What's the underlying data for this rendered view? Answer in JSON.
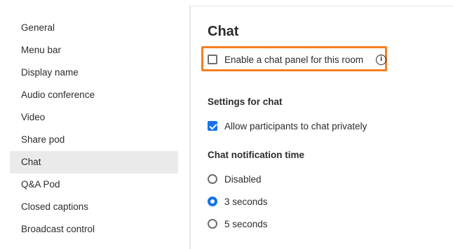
{
  "sidebar": {
    "items": [
      {
        "label": "General"
      },
      {
        "label": "Menu bar"
      },
      {
        "label": "Display name"
      },
      {
        "label": "Audio conference"
      },
      {
        "label": "Video"
      },
      {
        "label": "Share pod"
      },
      {
        "label": "Chat",
        "active": true
      },
      {
        "label": "Q&A Pod"
      },
      {
        "label": "Closed captions"
      },
      {
        "label": "Broadcast control"
      }
    ]
  },
  "main": {
    "title": "Chat",
    "enable_chat": {
      "label": "Enable a chat panel for this room",
      "checked": false,
      "info_icon": "info-icon",
      "highlight_color": "#f57f22"
    },
    "settings_heading": "Settings for chat",
    "allow_private": {
      "label": "Allow participants to chat privately",
      "checked": true
    },
    "notification_heading": "Chat notification time",
    "notification_options": [
      {
        "label": "Disabled",
        "selected": false
      },
      {
        "label": "3 seconds",
        "selected": true
      },
      {
        "label": "5 seconds",
        "selected": false
      }
    ]
  },
  "colors": {
    "accent": "#1473e6",
    "active_item_bg": "#eaeaea"
  }
}
